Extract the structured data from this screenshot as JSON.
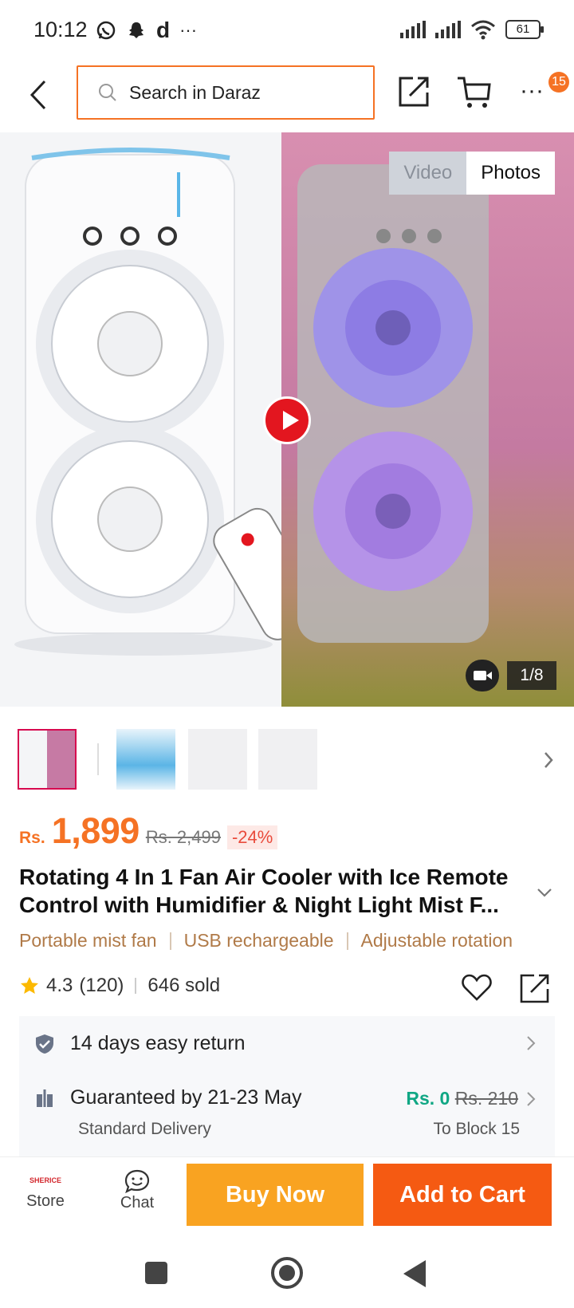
{
  "status_bar": {
    "time": "10:12",
    "app_letter": "d",
    "more": "···",
    "battery": "61"
  },
  "header": {
    "search_placeholder": "Search in Daraz",
    "badge_count": "15"
  },
  "gallery": {
    "tab_video": "Video",
    "tab_photos": "Photos",
    "counter": "1/8"
  },
  "product": {
    "currency": "Rs.",
    "price": "1,899",
    "old_price": "Rs. 2,499",
    "discount": "-24%",
    "title": "Rotating 4 In 1 Fan Air Cooler with Ice Remote Control with Humidifier & Night Light Mist F...",
    "tags": [
      "Portable mist fan",
      "USB rechargeable",
      "Adjustable rotation"
    ],
    "rating": "4.3",
    "reviews": "(120)",
    "sold": "646 sold"
  },
  "services": {
    "return": "14 days easy return",
    "delivery_title": "Guaranteed by 21-23 May",
    "delivery_type": "Standard Delivery",
    "fee_new": "Rs. 0",
    "fee_old": "Rs. 210",
    "destination": "To Block 15"
  },
  "actions": {
    "store_logo": "SHERICE",
    "store": "Store",
    "chat": "Chat",
    "buy_now": "Buy Now",
    "add_to_cart": "Add to Cart"
  },
  "colors": {
    "accent": "#f57224",
    "buy_now": "#f9a321",
    "add_to_cart": "#f55a12",
    "free_fee": "#10a784",
    "tag": "#b07a48"
  }
}
